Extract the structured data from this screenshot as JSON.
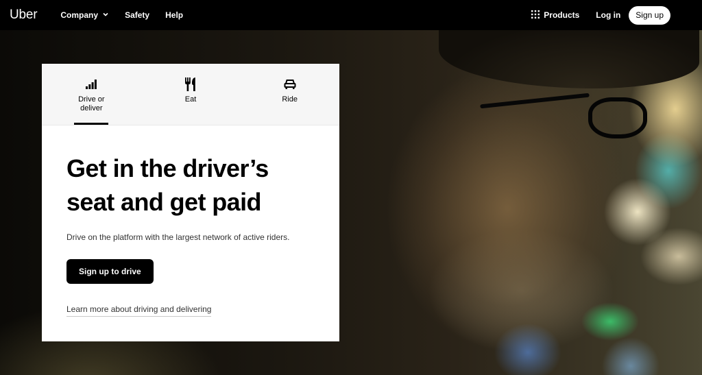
{
  "nav": {
    "logo": "Uber",
    "company": "Company",
    "safety": "Safety",
    "help": "Help",
    "products": "Products",
    "login": "Log in",
    "signup": "Sign up"
  },
  "tabs": [
    {
      "label": "Drive or deliver",
      "icon": "signal-bars-icon",
      "active": true
    },
    {
      "label": "Eat",
      "icon": "fork-knife-icon",
      "active": false
    },
    {
      "label": "Ride",
      "icon": "car-icon",
      "active": false
    }
  ],
  "hero": {
    "headline": "Get in the driver’s seat and get paid",
    "description": "Drive on the platform with the largest network of active riders.",
    "cta": "Sign up to drive",
    "learn_more": "Learn more about driving and delivering"
  }
}
